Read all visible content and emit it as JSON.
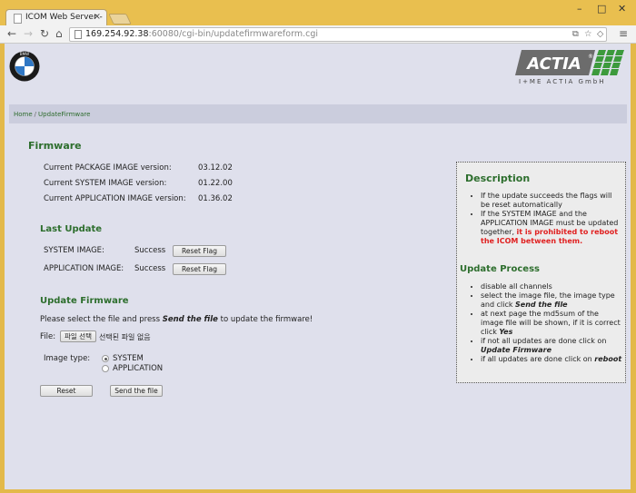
{
  "browser": {
    "tab_title": "ICOM Web Server -",
    "tab_close": "×",
    "url_host": "169.254.92.38",
    "url_port": ":60080",
    "url_path": "/cgi-bin/updatefirmwareform.cgi",
    "window_controls": {
      "minimize": "–",
      "maximize": "□",
      "close": "✕"
    }
  },
  "header": {
    "actia_logo_text": "ACTIA",
    "actia_registered": "®",
    "actia_subtitle": "I+ME ACTIA GmbH",
    "bmw_logo_text": "BMW"
  },
  "breadcrumb": {
    "home": "Home",
    "separator": "/",
    "current": "UpdateFirmware"
  },
  "firmware": {
    "title": "Firmware",
    "versions": [
      {
        "label": "Current PACKAGE IMAGE version:",
        "value": "03.12.02"
      },
      {
        "label": "Current SYSTEM IMAGE version:",
        "value": "01.22.00"
      },
      {
        "label": "Current APPLICATION IMAGE version:",
        "value": "01.36.02"
      }
    ]
  },
  "last_update": {
    "title": "Last Update",
    "rows": [
      {
        "label": "SYSTEM IMAGE:",
        "status": "Success",
        "button": "Reset Flag"
      },
      {
        "label": "APPLICATION IMAGE:",
        "status": "Success",
        "button": "Reset Flag"
      }
    ]
  },
  "update_firmware": {
    "title": "Update Firmware",
    "instruction_pre": "Please select the file and press ",
    "instruction_em": "Send the file",
    "instruction_post": " to update the firmware!",
    "file_label": "File:",
    "file_button": "파일 선택",
    "file_status": "선택된 파일 없음",
    "image_type_label": "Image type:",
    "image_types": [
      {
        "label": "SYSTEM",
        "checked": true
      },
      {
        "label": "APPLICATION",
        "checked": false
      }
    ],
    "reset_button": "Reset",
    "send_button": "Send the file"
  },
  "description": {
    "title": "Description",
    "item1": "If the update succeeds the flags will be reset automatically",
    "item2_pre": "If the SYSTEM IMAGE and the APPLICATION IMAGE must be updated together, ",
    "item2_red": "it is prohibited to reboot the ICOM between them.",
    "process_title": "Update Process",
    "p1": "disable all channels",
    "p2_pre": "select the image file, the image type and click ",
    "p2_em": "Send the file",
    "p3_pre": "at next page the md5sum of the image file will be shown, if it is correct click ",
    "p3_em": "Yes",
    "p4_pre": "if not all updates are done click on ",
    "p4_em": "Update Firmware",
    "p5_pre": "if all updates are done click on ",
    "p5_em": "reboot"
  }
}
